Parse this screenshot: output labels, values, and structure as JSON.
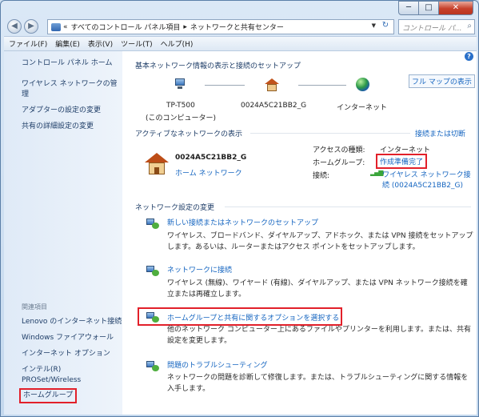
{
  "window": {
    "minimize_label": "─",
    "maximize_label": "□",
    "close_label": "✕"
  },
  "nav": {
    "back_label": "◀",
    "forward_label": "▶",
    "address_chevron": "«",
    "address_seg1": "すべてのコントロール パネル項目",
    "address_arrow": "▸",
    "address_seg2": "ネットワークと共有センター",
    "search_placeholder": "コントロール パ..."
  },
  "menu": [
    "ファイル(F)",
    "編集(E)",
    "表示(V)",
    "ツール(T)",
    "ヘルプ(H)"
  ],
  "left_pane": {
    "links": [
      "コントロール パネル ホーム",
      "ワイヤレス ネットワークの管",
      "理",
      "アダプターの設定の変更",
      "共有の詳細設定の変更"
    ],
    "related_title": "関連項目",
    "related": [
      "Lenovo のインターネット接続",
      "Windows ファイアウォール",
      "インターネット オプション",
      "インテル(R)",
      "PROSet/Wireless",
      "ホームグループ"
    ]
  },
  "main": {
    "title": "基本ネットワーク情報の表示と接続のセットアップ",
    "full_map": "フル マップの表示",
    "computer_name": "TP-T500",
    "computer_sub": "(このコンピューター)",
    "network_name": "0024A5C21BB2_G",
    "internet": "インターネット",
    "active_header": "アクティブなネットワークの表示",
    "connect_disconnect": "接続または切断",
    "active_network_name": "0024A5C21BB2_G",
    "active_network_type": "ホーム ネットワーク",
    "access_type_label": "アクセスの種類:",
    "access_type_value": "インターネット",
    "homegroup_label": "ホームグループ:",
    "homegroup_value": "作成準備完了",
    "connections_label": "接続:",
    "connections_value_1": "ワイヤレス ネットワーク接",
    "connections_value_2": "続 (0024A5C21BB2_G)",
    "change_header": "ネットワーク設定の変更",
    "tasks": [
      {
        "title": "新しい接続またはネットワークのセットアップ",
        "desc1": "ワイヤレス、ブロードバンド、ダイヤルアップ、アドホック、または VPN 接続をセットアップ",
        "desc2": "します。あるいは、ルーターまたはアクセス ポイントをセットアップします。"
      },
      {
        "title": "ネットワークに接続",
        "desc1": "ワイヤレス (無線)、ワイヤード (有線)、ダイヤルアップ、または VPN ネットワーク接続を確",
        "desc2": "立または再確立します。"
      },
      {
        "title": "ホームグループと共有に関するオプションを選択する",
        "desc1": "他のネットワーク コンピューター上にあるファイルやプリンターを利用します。または、共有",
        "desc2": "設定を変更します。"
      },
      {
        "title": "問題のトラブルシューティング",
        "desc1": "ネットワークの問題を診断して修復します。または、トラブルシューティングに関する情報を",
        "desc2": "入手します。"
      }
    ]
  },
  "colors": {
    "link": "#1565c0",
    "highlight": "#e2202a",
    "close_button": "#c7402b"
  }
}
